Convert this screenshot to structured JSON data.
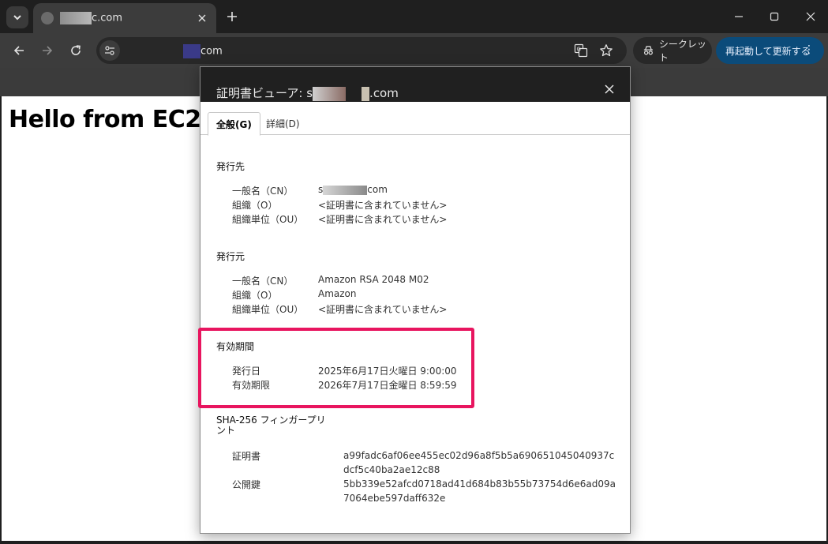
{
  "browser": {
    "tab": {
      "title": "c.com"
    },
    "address": {
      "url": "com"
    },
    "incognito_label": "シークレット",
    "relaunch_label": "再起動して更新する"
  },
  "page": {
    "heading": "Hello from EC2!"
  },
  "dialog": {
    "title": "証明書ビューア: s",
    "title_suffix": ".com",
    "tabs": [
      {
        "label": "全般(G)",
        "active": true
      },
      {
        "label": "詳細(D)",
        "active": false
      }
    ],
    "issued_to": {
      "title": "発行先",
      "rows": [
        {
          "label": "一般名（CN）",
          "value": "s",
          "value_suffix": "com"
        },
        {
          "label": "組織（O）",
          "value": "<証明書に含まれていません>"
        },
        {
          "label": "組織単位（OU）",
          "value": "<証明書に含まれていません>"
        }
      ]
    },
    "issued_by": {
      "title": "発行元",
      "rows": [
        {
          "label": "一般名（CN）",
          "value": "Amazon RSA 2048 M02"
        },
        {
          "label": "組織（O）",
          "value": "Amazon"
        },
        {
          "label": "組織単位（OU）",
          "value": "<証明書に含まれていません>"
        }
      ]
    },
    "validity": {
      "title": "有効期間",
      "rows": [
        {
          "label": "発行日",
          "value": "2025年6月17日火曜日 9:00:00"
        },
        {
          "label": "有効期限",
          "value": "2026年7月17日金曜日 8:59:59"
        }
      ]
    },
    "fingerprints": {
      "title_line1": "SHA-256 フィンガープリ",
      "title_line2": "ント",
      "rows": [
        {
          "label": "証明書",
          "value": "a99fadc6af06ee455ec02d96a8f5b5a690651045040937cdcf5c40ba2ae12c88"
        },
        {
          "label": "公開鍵",
          "value": "5bb339e52afcd0718ad41d684b83b55b73754d6e6ad09a7064ebe597daff632e"
        }
      ]
    }
  },
  "colors": {
    "highlight": "#e8155f",
    "relaunch_button": "#0b4b7a"
  }
}
